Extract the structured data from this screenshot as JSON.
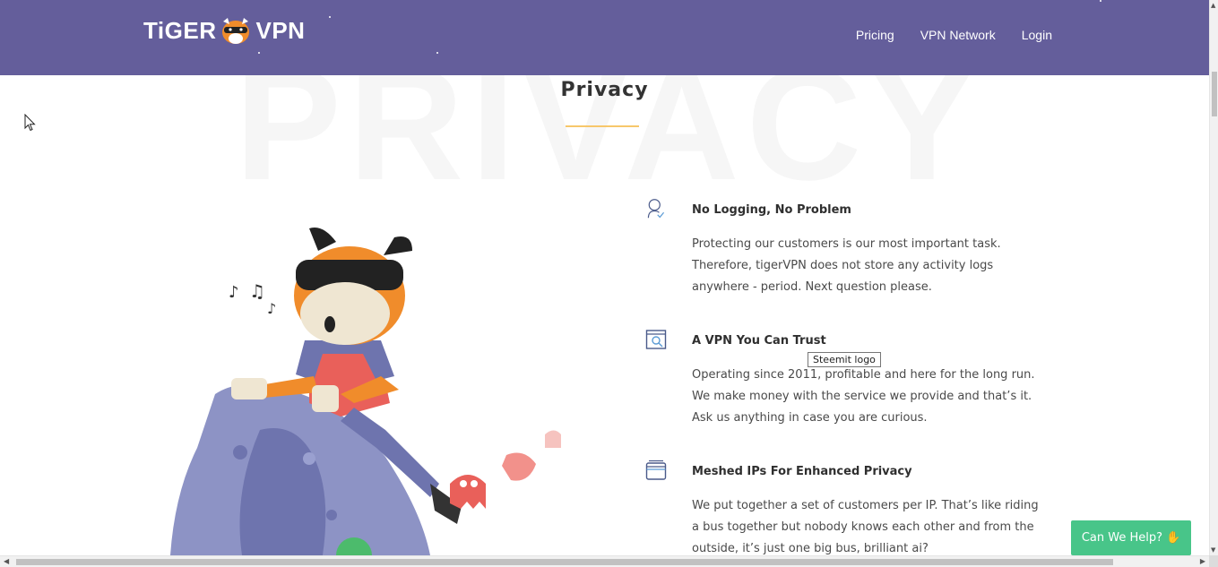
{
  "header": {
    "logo_left": "TiGER",
    "logo_right": "VPN",
    "nav": [
      {
        "label": "Pricing"
      },
      {
        "label": "VPN Network"
      },
      {
        "label": "Login"
      }
    ],
    "color": "#645e9b"
  },
  "section": {
    "background_word": "PRIVACY",
    "title": "Privacy",
    "underline_color": "#f7c76b"
  },
  "features": [
    {
      "icon": "user-check-icon",
      "title": "No Logging, No Problem",
      "lines": [
        "Protecting our customers is our most important task.",
        "Therefore, tigerVPN does not store any activity logs",
        "anywhere - period. Next question please."
      ]
    },
    {
      "icon": "window-search-icon",
      "title": "A VPN You Can Trust",
      "lines": [
        "Operating since 2011, profitable and here for the long run.",
        "We make money with the service we provide and that’s it.",
        "Ask us anything in case you are curious."
      ]
    },
    {
      "icon": "stacked-windows-icon",
      "title": "Meshed IPs For Enhanced Privacy",
      "lines": [
        "We put together a set of customers per IP. That’s like riding",
        "a bus together but nobody knows each other and from the",
        "outside, it’s just one big bus, brilliant ai?"
      ]
    }
  ],
  "tooltip": "Steemit logo",
  "help_button": {
    "label": "Can We Help?",
    "icon": "waving-hand-icon",
    "color": "#48c589"
  }
}
